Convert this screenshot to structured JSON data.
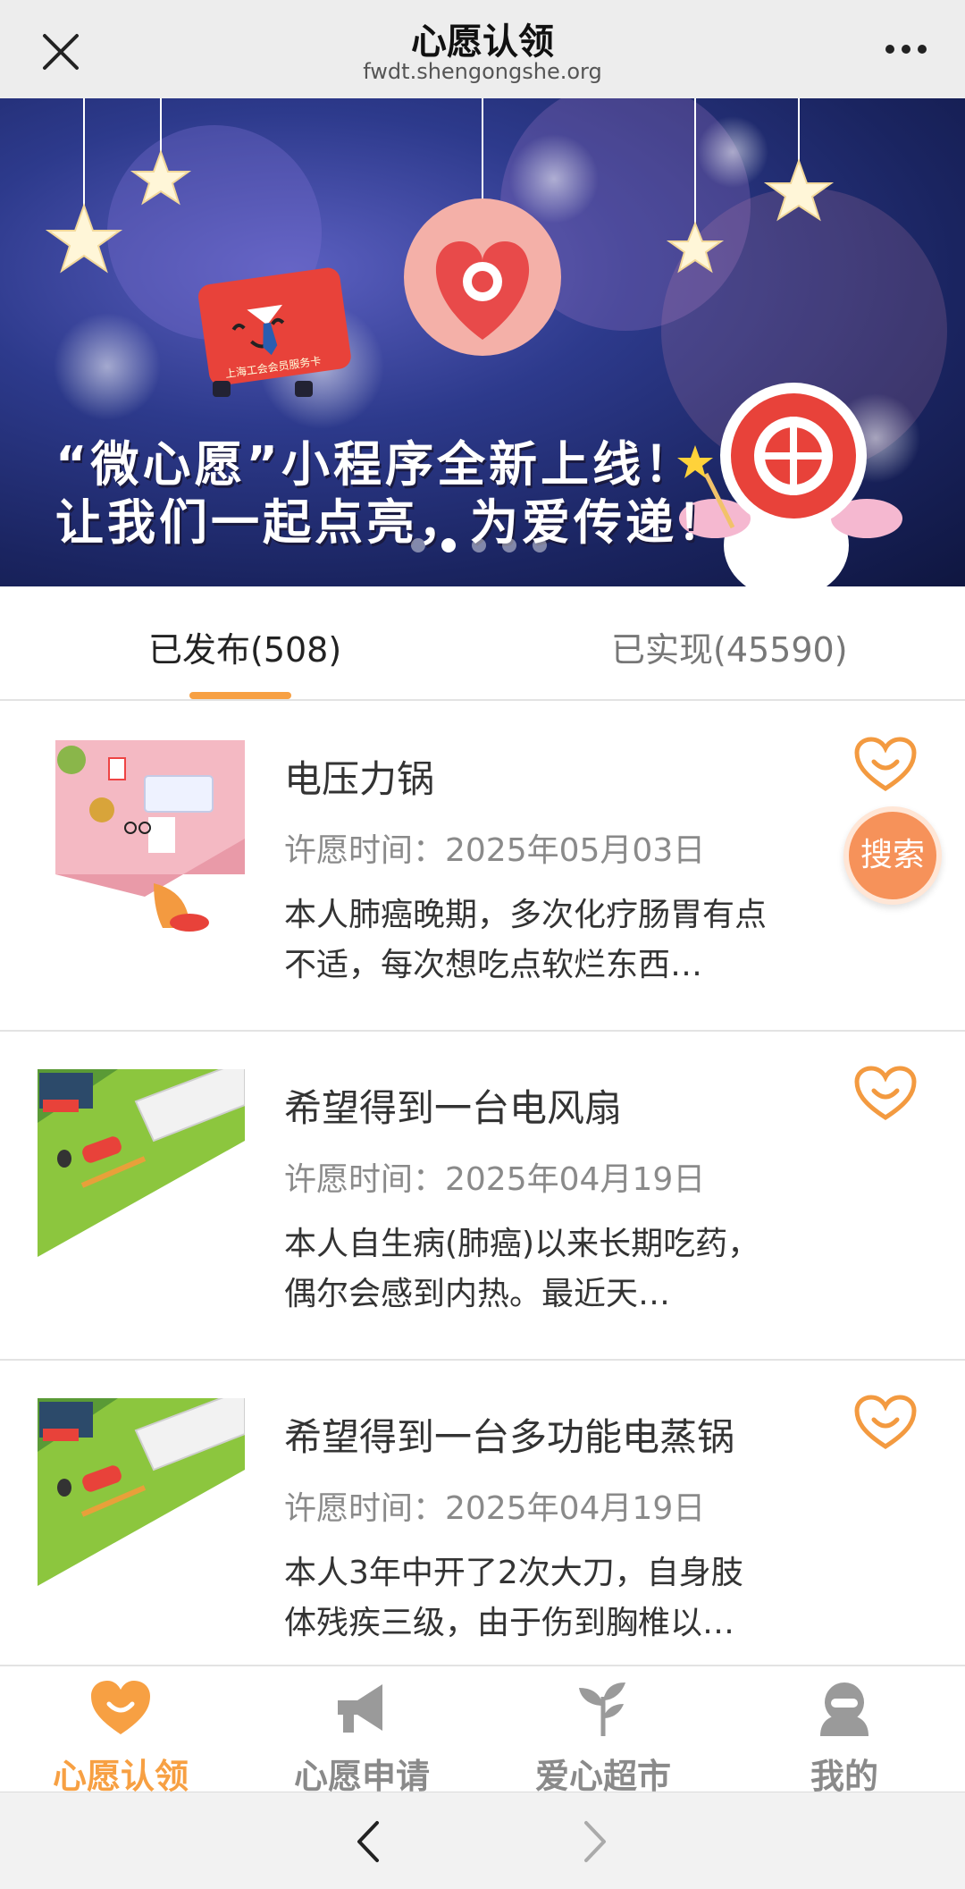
{
  "header": {
    "title": "心愿认领",
    "domain": "fwdt.shengongshe.org",
    "close_icon": "close-icon",
    "more_icon": "more-icon"
  },
  "banner": {
    "line1": "“微心愿”小程序全新上线！",
    "line2": "让我们一起点亮，为爱传递！",
    "card_text": "上海工会会员服务卡",
    "slide_count": 5,
    "active_slide": 2
  },
  "tabs": [
    {
      "label": "已发布(508)",
      "active": true
    },
    {
      "label": "已实现(45590)",
      "active": false
    }
  ],
  "wishes": [
    {
      "title": "电压力锅",
      "time": "许愿时间：2025年05月03日",
      "desc": "本人肺癌晚期，多次化疗肠胃有点不适，每次想吃点软烂东西…"
    },
    {
      "title": "希望得到一台电风扇",
      "time": "许愿时间：2025年04月19日",
      "desc": "本人自生病(肺癌)以来长期吃药，偶尔会感到内热。最近天…"
    },
    {
      "title": "希望得到一台多功能电蒸锅",
      "time": "许愿时间：2025年04月19日",
      "desc": "本人3年中开了2次大刀，自身肢体残疾三级，由于伤到胸椎以…"
    }
  ],
  "search_button": "搜索",
  "bottom_nav": [
    {
      "label": "心愿认领",
      "icon": "heart-icon",
      "active": true
    },
    {
      "label": "心愿申请",
      "icon": "megaphone-icon",
      "active": false
    },
    {
      "label": "爱心超市",
      "icon": "sprout-icon",
      "active": false
    },
    {
      "label": "我的",
      "icon": "user-icon",
      "active": false
    }
  ],
  "colors": {
    "accent": "#f7a043",
    "fab": "#f6925a",
    "muted": "#8a8a8a"
  }
}
